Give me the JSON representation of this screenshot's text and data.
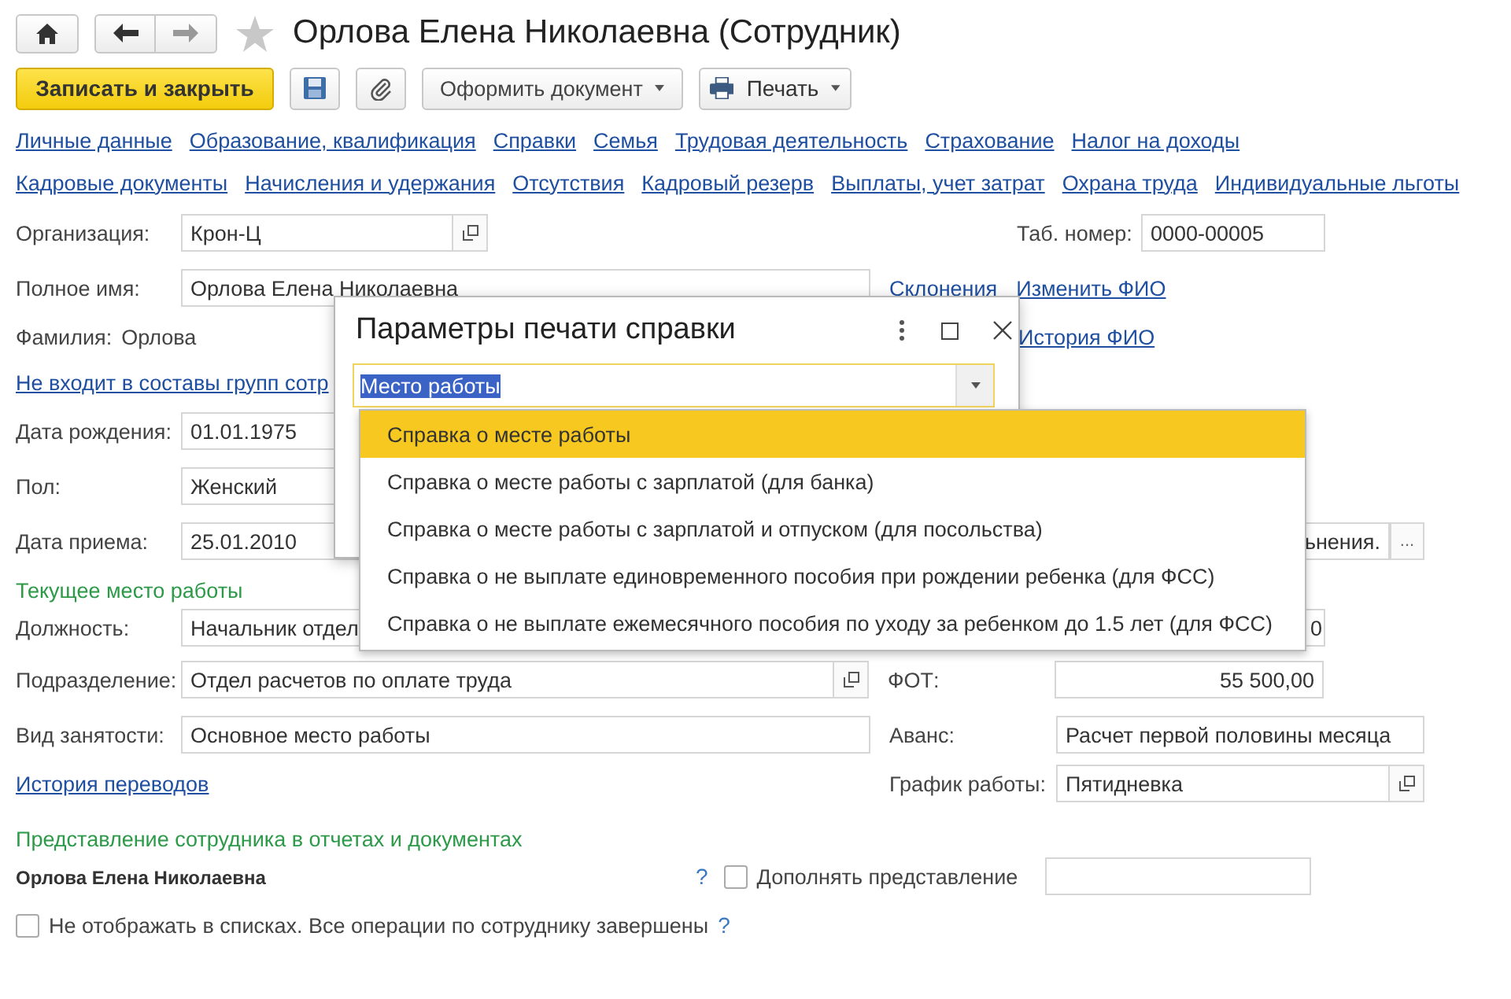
{
  "window": {
    "title": "Орлова Елена Николаевна (Сотрудник)",
    "favorite": false
  },
  "toolbar": {
    "primary": "Записать и закрыть",
    "menus": [
      {
        "kind": "plain",
        "label": "Оформить документ"
      },
      {
        "kind": "print",
        "label": "Печать"
      }
    ]
  },
  "links": [
    [
      "Личные данные",
      "Образование, квалификация",
      "Справки",
      "Семья",
      "Трудовая деятельность",
      "Страхование",
      "Налог на доходы"
    ],
    [
      "Кадровые документы",
      "Начисления и удержания",
      "Отсутствия",
      "Кадровый резерв",
      "Выплаты, учет затрат",
      "Охрана труда",
      "Индивидуальные льготы"
    ]
  ],
  "form": {
    "organization": {
      "label": "Организация:",
      "value": "Крон-Ц"
    },
    "tab_number": {
      "label": "Таб. номер:",
      "value": "0000-00005"
    },
    "full_name": {
      "label": "Полное имя:",
      "value": "Орлова Елена Николаевна"
    },
    "name_links": [
      "Склонения",
      "Изменить ФИО"
    ],
    "surname": {
      "label": "Фамилия:",
      "value": "Орлова"
    },
    "name_history_link": "История ФИО",
    "groups_link": "Не входит в составы групп сотр",
    "birth_date": {
      "label": "Дата рождения:",
      "value": "01.01.1975"
    },
    "gender": {
      "label": "Пол:",
      "value": "Женский"
    },
    "hire_date": {
      "label": "Дата приема:",
      "value": "25.01.2010"
    },
    "dismissal": {
      "value": "ьнения.",
      "button": "..."
    },
    "current_job_heading": "Текущее место работы",
    "position": {
      "label": "Должность:",
      "value": "Начальник отдел"
    },
    "position_right": {
      "value": "0"
    },
    "department": {
      "label": "Подразделение:",
      "value": "Отдел расчетов по оплате труда"
    },
    "payroll": {
      "label": "ФОТ:",
      "value": "55 500,00"
    },
    "employment": {
      "label": "Вид занятости:",
      "value": "Основное место работы"
    },
    "advance": {
      "label": "Аванс:",
      "value": "Расчет первой половины месяца"
    },
    "transfers_link": "История переводов",
    "schedule": {
      "label": "График работы:",
      "value": "Пятидневка"
    },
    "presentation_heading": "Представление сотрудника в отчетах и документах",
    "presentation": "Орлова Елена Николаевна",
    "presentation_help": "?",
    "extend": {
      "label": "Дополнять представление",
      "checked": false
    },
    "hide": {
      "label": "Не отображать в списках. Все операции по сотруднику завершены",
      "checked": false,
      "help": "?"
    }
  },
  "dialog": {
    "title": "Параметры печати справки",
    "value": "Место работы",
    "value_highlighted": true,
    "options": [
      {
        "label": "Справка о месте работы",
        "selected": true
      },
      {
        "label": "Справка о месте работы с зарплатой (для банка)",
        "selected": false
      },
      {
        "label": "Справка о месте работы с зарплатой и отпуском (для посольства)",
        "selected": false
      },
      {
        "label": "Справка о не выплате единовременного пособия при рождении ребенка (для ФСС)",
        "selected": false
      },
      {
        "label": "Справка о не выплате ежемесячного пособия по уходу за ребенком до 1.5 лет (для ФСС)",
        "selected": false
      }
    ]
  }
}
